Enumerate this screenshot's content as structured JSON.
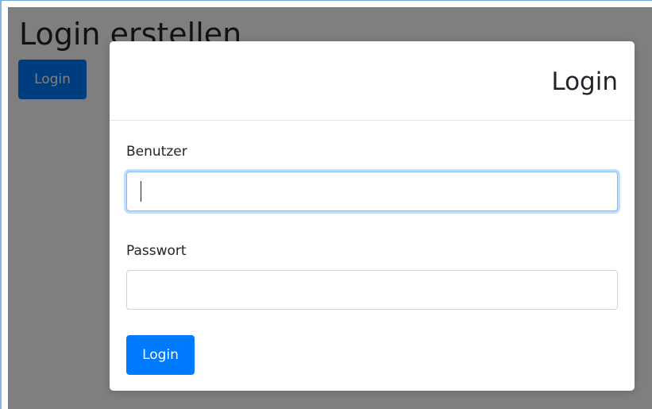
{
  "page": {
    "title": "Login erstellen",
    "login_button_label": "Login"
  },
  "modal": {
    "title": "Login",
    "username": {
      "label": "Benutzer",
      "value": "",
      "placeholder": ""
    },
    "password": {
      "label": "Passwort",
      "value": "",
      "placeholder": ""
    },
    "submit_label": "Login"
  },
  "colors": {
    "primary": "#007bff",
    "backdrop": "rgba(0,0,0,0.5)",
    "focus_border": "#80bdff"
  }
}
